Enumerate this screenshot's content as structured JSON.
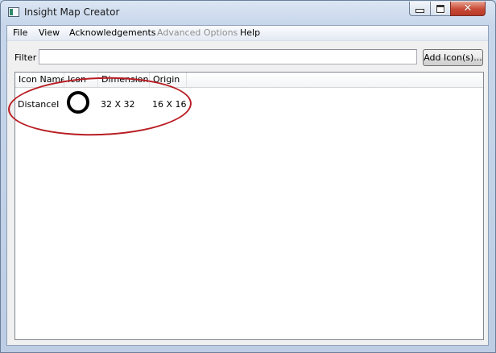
{
  "window": {
    "title": "Insight Map Creator",
    "controls": {
      "minimize": "minimize",
      "maximize": "maximize",
      "close": "✕"
    }
  },
  "menu": {
    "items": [
      {
        "label": "File",
        "enabled": true
      },
      {
        "label": "View",
        "enabled": true
      },
      {
        "label": "Acknowledgements",
        "enabled": true
      },
      {
        "label": "Advanced Options",
        "enabled": false
      },
      {
        "label": "Help",
        "enabled": true
      }
    ]
  },
  "filter": {
    "label": "Filter",
    "value": "",
    "placeholder": ""
  },
  "toolbar": {
    "add_icons_label": "Add Icon(s)..."
  },
  "table": {
    "columns": [
      "Icon Name",
      "Icon",
      "Dimensions",
      "Origin"
    ],
    "rows": [
      {
        "icon_name": "DistanceI",
        "icon": "circle-outline-icon",
        "dimensions": "32 X 32",
        "origin": "16 X 16"
      }
    ]
  },
  "annotation": {
    "color": "#b81c22",
    "shape": "ellipse"
  },
  "colors": {
    "close_button": "#c74a36",
    "frame": "#c7d6ea"
  }
}
